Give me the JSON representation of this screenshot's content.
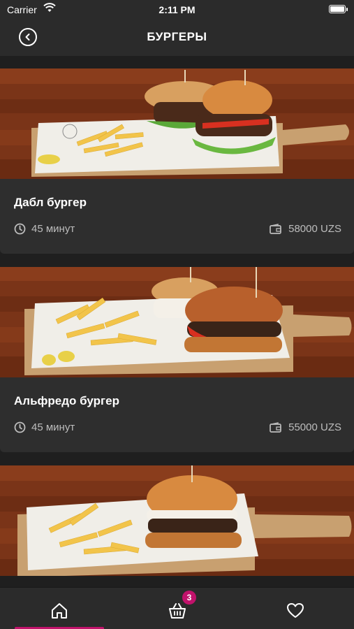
{
  "status_bar": {
    "carrier": "Carrier",
    "time": "2:11 PM"
  },
  "header": {
    "title": "БУРГЕРЫ",
    "back_icon": "back-arrow-circle-icon"
  },
  "products": [
    {
      "name": "Дабл бургер",
      "prep_time": "45 минут",
      "price": "58000 UZS"
    },
    {
      "name": "Альфредо бургер",
      "prep_time": "45 минут",
      "price": "55000 UZS"
    },
    {
      "name": "",
      "prep_time": "",
      "price": ""
    }
  ],
  "tab_bar": {
    "tabs": [
      {
        "icon": "home-icon",
        "active": true
      },
      {
        "icon": "basket-icon",
        "active": false,
        "badge": "3"
      },
      {
        "icon": "heart-icon",
        "active": false
      }
    ]
  },
  "colors": {
    "background": "#1f1f1f",
    "bar": "#2b2b2b",
    "card": "#2e2e2e",
    "accent": "#c1126b",
    "muted_text": "#bdbdbd"
  }
}
